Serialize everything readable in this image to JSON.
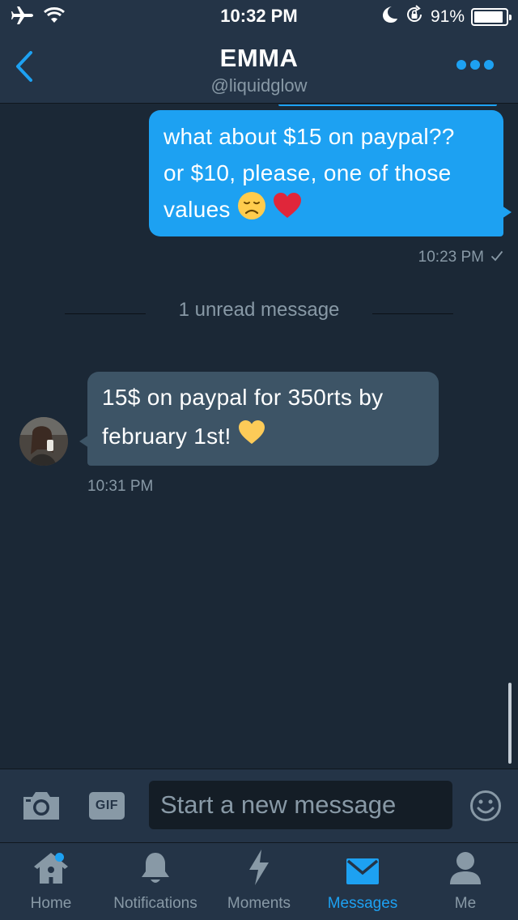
{
  "status_bar": {
    "time": "10:32 PM",
    "battery_percent": "91%",
    "battery_level": 0.91,
    "icons": [
      "airplane-icon",
      "wifi-icon",
      "moon-icon",
      "rotation-lock-icon",
      "battery-icon"
    ]
  },
  "header": {
    "name": "EMMA",
    "handle": "@liquidglow",
    "back_icon": "chevron-left-icon",
    "more_icon": "more-dots-icon"
  },
  "conversation": {
    "outgoing": {
      "lines": [
        "what about $15 on paypal??",
        "or $10, please, one of those",
        "values"
      ],
      "emojis": [
        "disappointed-face-emoji",
        "red-heart-emoji"
      ],
      "time": "10:23 PM",
      "status_icon": "checkmark-icon"
    },
    "unread_divider": "1 unread message",
    "incoming": {
      "lines": [
        "15$ on paypal for 350rts by",
        "february 1st!"
      ],
      "emojis": [
        "yellow-heart-emoji"
      ],
      "time": "10:31 PM"
    }
  },
  "composer": {
    "placeholder": "Start a new message",
    "gif_label": "GIF",
    "camera_icon": "camera-icon",
    "emoji_icon": "smiley-icon"
  },
  "tabbar": {
    "tabs": [
      {
        "label": "Home",
        "icon": "home-icon",
        "has_dot": true
      },
      {
        "label": "Notifications",
        "icon": "bell-icon"
      },
      {
        "label": "Moments",
        "icon": "lightning-icon"
      },
      {
        "label": "Messages",
        "icon": "envelope-icon",
        "active": true
      },
      {
        "label": "Me",
        "icon": "person-icon"
      }
    ]
  },
  "colors": {
    "accent": "#1da1f2",
    "background": "#1b2836",
    "bar": "#243447",
    "muted": "#8899a6",
    "incoming_bubble": "#3d5466"
  }
}
